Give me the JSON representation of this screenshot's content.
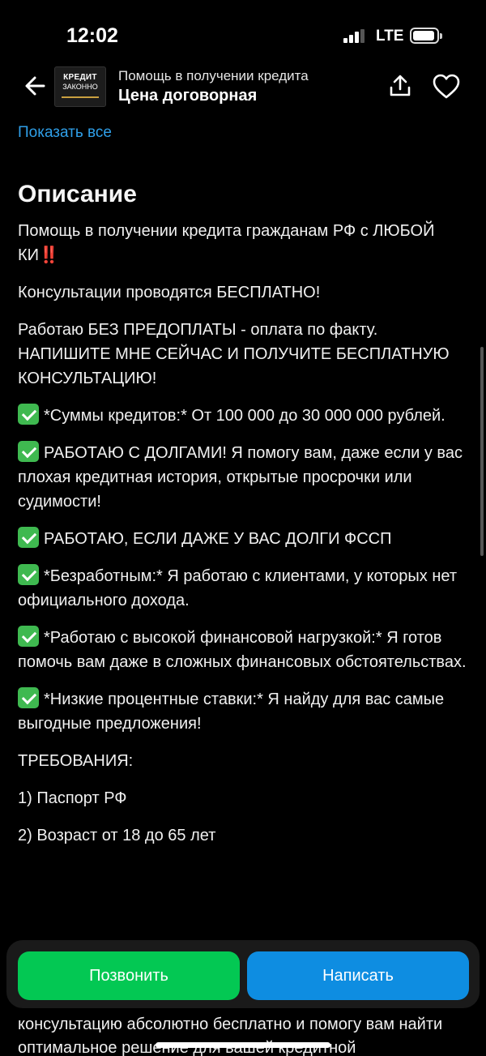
{
  "status": {
    "time": "12:02",
    "network": "LTE"
  },
  "header": {
    "logo_line1": "КРЕДИТ",
    "logo_line2": "ЗАКОННО",
    "subtitle": "Помощь в получении кредита",
    "title": "Цена договорная"
  },
  "content": {
    "show_all": "Показать все",
    "section_title": "Описание",
    "p1": "Помощь в получении кредита гражданам РФ с ЛЮБОЙ КИ",
    "p1_marks": "‼️",
    "p2": "Консультации проводятся БЕСПЛАТНО!",
    "p3": "Работаю БЕЗ ПРЕДОПЛАТЫ - оплата по факту.\nНАПИШИТЕ МНЕ СЕЙЧАС И ПОЛУЧИТЕ БЕСПЛАТНУЮ КОНСУЛЬТАЦИЮ!",
    "items": [
      "*Суммы кредитов:* От 100 000 до 30 000 000 рублей.",
      "РАБОТАЮ С ДОЛГАМИ! Я помогу вам, даже если у вас плохая кредитная история, открытые просрочки или судимости!",
      "РАБОТАЮ, ЕСЛИ ДАЖЕ У ВАС ДОЛГИ ФССП",
      "*Безработным:* Я работаю с клиентами, у которых нет официального дохода.",
      "*Работаю с высокой финансовой нагрузкой:* Я готов помочь вам даже в сложных финансовых обстоятельствах.",
      "*Низкие процентные ставки:* Я найду для вас самые выгодные предложения!"
    ],
    "requirements_title": "ТРЕБОВАНИЯ:",
    "req1": "1) Паспорт РФ",
    "req2": "2) Возраст от 18 до 65 лет",
    "bottom_text": "консультацию абсолютно бесплатно и помогу вам найти оптимальное решение для вашей кредитной"
  },
  "actions": {
    "call_label": "Позвонить",
    "write_label": "Написать"
  },
  "colors": {
    "call": "#03c853",
    "write": "#0e8de1",
    "link": "#2f9fe8",
    "check": "#3fb950"
  }
}
